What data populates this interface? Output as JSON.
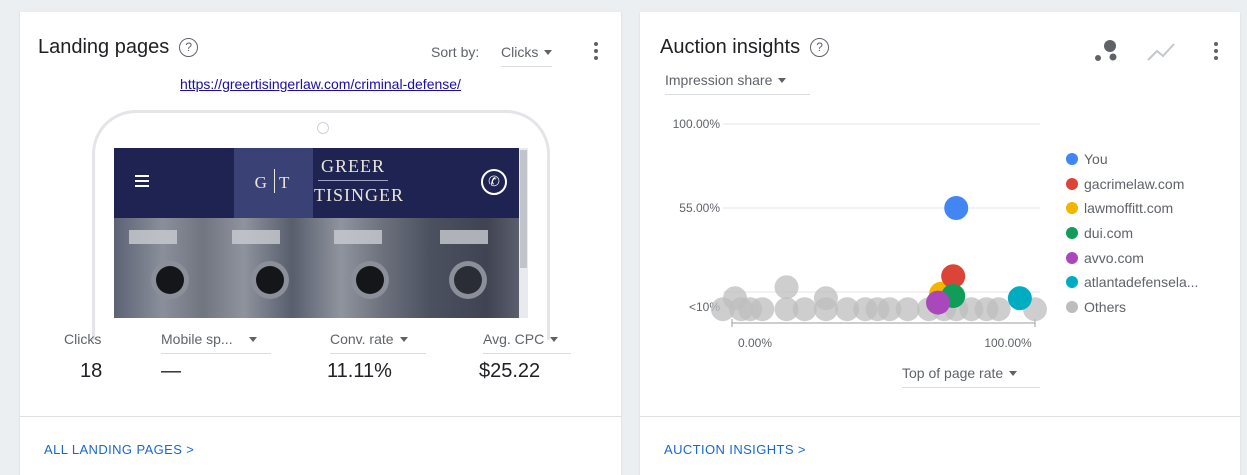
{
  "landing": {
    "title": "Landing pages",
    "help_icon": "?",
    "sort_label": "Sort by:",
    "sort_value": "Clicks",
    "url": "https://greertisingerlaw.com/criminal-defense/",
    "preview": {
      "logo_g": "G",
      "logo_t": "T",
      "name_line1": "GREER",
      "name_line2": "TISINGER"
    },
    "metrics": [
      {
        "label": "Clicks",
        "value": "18"
      },
      {
        "label": "Mobile sp...",
        "value": "—"
      },
      {
        "label": "Conv. rate",
        "value": "11.11%"
      },
      {
        "label": "Avg. CPC",
        "value": "$25.22"
      }
    ],
    "footer_link": "ALL LANDING PAGES >"
  },
  "auction": {
    "title": "Auction insights",
    "help_icon": "?",
    "metric_dropdown": "Impression share",
    "x_dropdown": "Top of page rate"
  },
  "chart_data": {
    "type": "scatter",
    "y_tick_labels": [
      "100.00%",
      "55.00%",
      "<10%"
    ],
    "x_tick_labels": [
      "0.00%",
      "100.00%"
    ],
    "xlim": [
      0,
      100
    ],
    "y_ticks": [
      10,
      55,
      100
    ],
    "legend": [
      {
        "name": "You",
        "color": "#4285f4"
      },
      {
        "name": "gacrimelaw.com",
        "color": "#db4437"
      },
      {
        "name": "lawmoffitt.com",
        "color": "#f4b400"
      },
      {
        "name": "dui.com",
        "color": "#0f9d58"
      },
      {
        "name": "avvo.com",
        "color": "#ab47bc"
      },
      {
        "name": "atlantadefensela...",
        "color": "#00acc1"
      },
      {
        "name": "Others",
        "color": "#bdbdbd"
      }
    ],
    "series": [
      {
        "name": "You",
        "points": [
          [
            74,
            55
          ]
        ]
      },
      {
        "name": "gacrimelaw.com",
        "points": [
          [
            73,
            24
          ]
        ]
      },
      {
        "name": "lawmoffitt.com",
        "points": [
          [
            69,
            16
          ]
        ]
      },
      {
        "name": "dui.com",
        "points": [
          [
            73,
            15
          ]
        ]
      },
      {
        "name": "avvo.com",
        "points": [
          [
            68,
            12
          ]
        ]
      },
      {
        "name": "atlantadefensela...",
        "points": [
          [
            95,
            14
          ]
        ]
      },
      {
        "name": "Others",
        "points": [
          [
            -3,
            9
          ],
          [
            1,
            14
          ],
          [
            3,
            9
          ],
          [
            6,
            9
          ],
          [
            10,
            9
          ],
          [
            18,
            19
          ],
          [
            18,
            9
          ],
          [
            24,
            9
          ],
          [
            31,
            14
          ],
          [
            31,
            9
          ],
          [
            38,
            9
          ],
          [
            44,
            9
          ],
          [
            48,
            9
          ],
          [
            52,
            9
          ],
          [
            58,
            9
          ],
          [
            65,
            9
          ],
          [
            70,
            9
          ],
          [
            74,
            9
          ],
          [
            79,
            9
          ],
          [
            84,
            9
          ],
          [
            88,
            9
          ],
          [
            100,
            9
          ]
        ]
      }
    ]
  }
}
